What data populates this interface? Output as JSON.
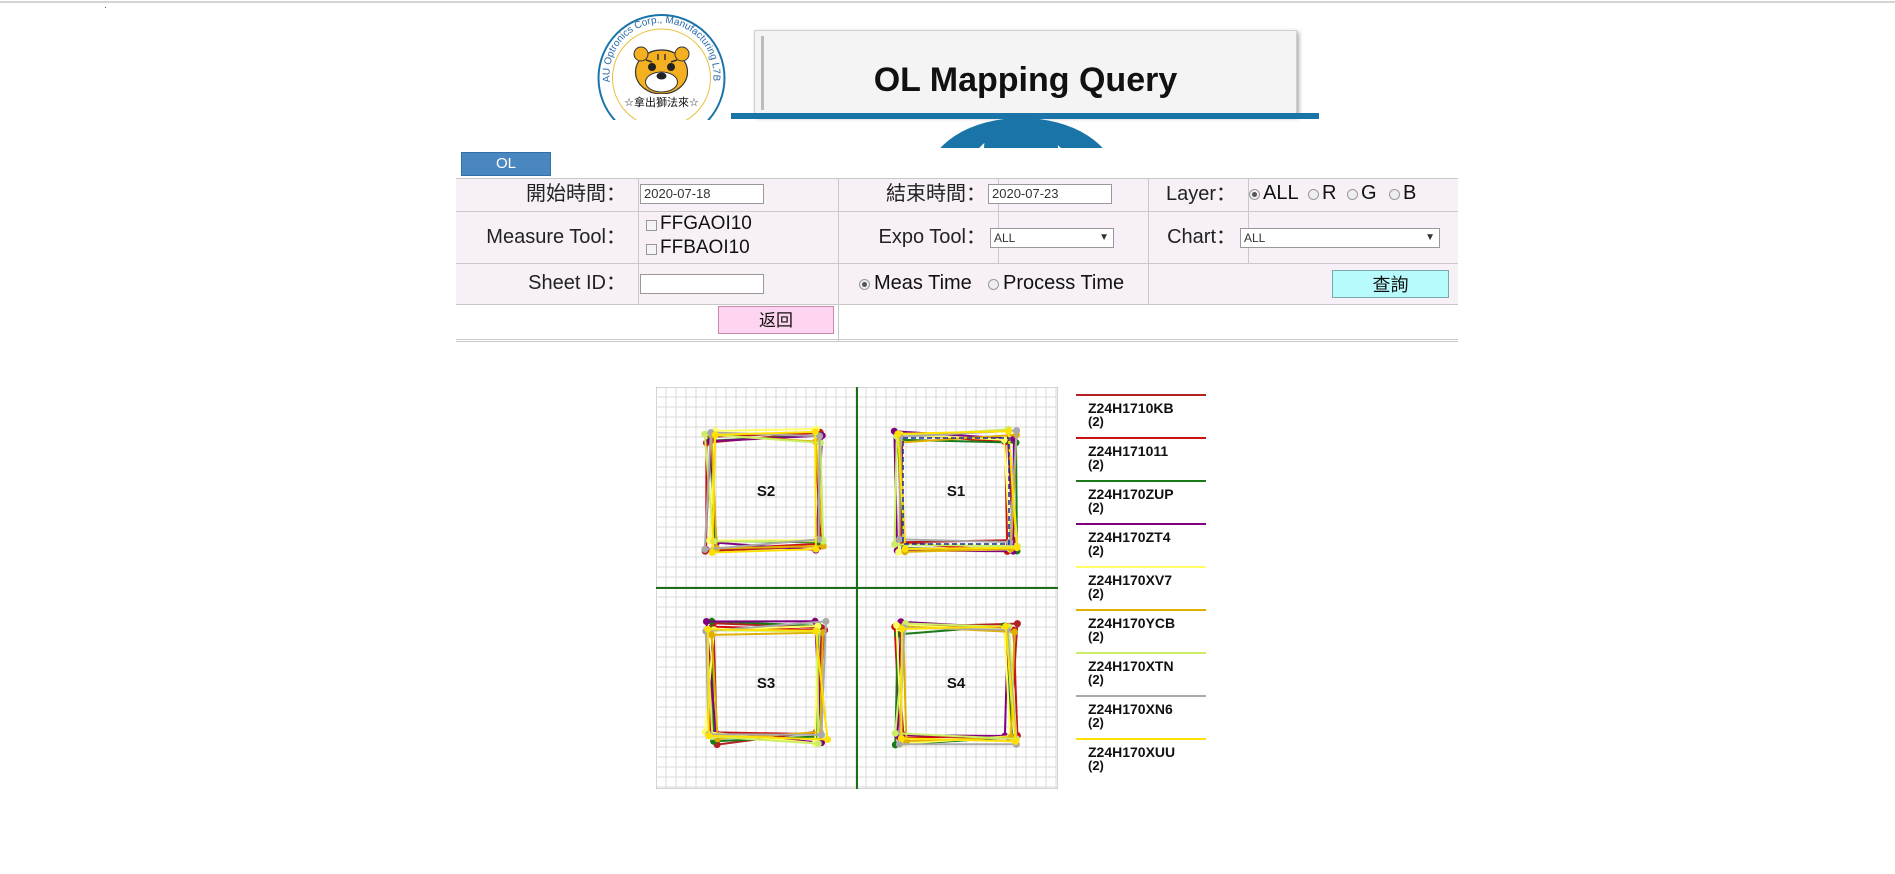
{
  "header": {
    "title": "OL Mapping Query",
    "logo_text": "AU Optronics Corp., Manufacturing L7B",
    "logo_motto": "☆拿出獅法來☆"
  },
  "tab": {
    "label": "OL"
  },
  "form": {
    "start_label": "開始時間：",
    "start_value": "2020-07-18",
    "end_label": "結束時間：",
    "end_value": "2020-07-23",
    "layer_label": "Layer：",
    "layer_options": [
      "ALL",
      "R",
      "G",
      "B"
    ],
    "layer_selected": "ALL",
    "measure_tool_label": "Measure Tool：",
    "measure_tools": [
      "FFGAOI10",
      "FFBAOI10"
    ],
    "expo_tool_label": "Expo Tool：",
    "expo_tool_value": "ALL",
    "chart_label": "Chart：",
    "chart_value": "ALL",
    "sheet_id_label": "Sheet ID：",
    "sheet_id_value": "",
    "time_options": [
      "Meas Time",
      "Process Time"
    ],
    "time_selected": "Meas Time",
    "query_button": "查詢",
    "back_button": "返回"
  },
  "chart_data": {
    "type": "scatter",
    "panels": [
      "S2",
      "S1",
      "S3",
      "S4"
    ],
    "grid": true,
    "legend_position": "right",
    "series": [
      {
        "name": "Z24H1710KB",
        "count": "(2)",
        "color": "#b22222"
      },
      {
        "name": "Z24H171011",
        "count": "(2)",
        "color": "#cc1111"
      },
      {
        "name": "Z24H170ZUP",
        "count": "(2)",
        "color": "#1a7a1a"
      },
      {
        "name": "Z24H170ZT4",
        "count": "(2)",
        "color": "#800080"
      },
      {
        "name": "Z24H170XV7",
        "count": "(2)",
        "color": "#ffff66"
      },
      {
        "name": "Z24H170YCB",
        "count": "(2)",
        "color": "#e0b000"
      },
      {
        "name": "Z24H170XTN",
        "count": "(2)",
        "color": "#ccee66"
      },
      {
        "name": "Z24H170XN6",
        "count": "(2)",
        "color": "#a9a9a9"
      },
      {
        "name": "Z24H170XUU",
        "count": "(2)",
        "color": "#ffe000"
      }
    ]
  }
}
